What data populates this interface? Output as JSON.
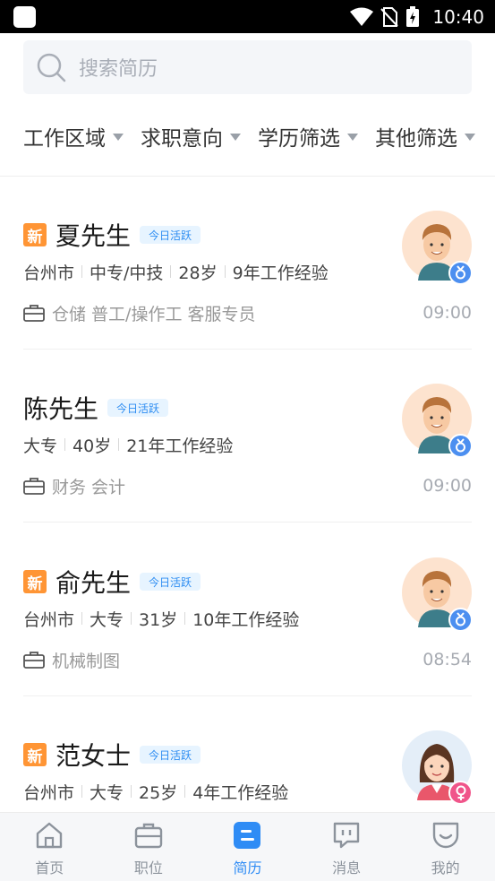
{
  "status_bar": {
    "time": "10:40"
  },
  "search": {
    "placeholder": "搜索简历"
  },
  "filters": [
    {
      "label": "工作区域"
    },
    {
      "label": "求职意向"
    },
    {
      "label": "学历筛选"
    },
    {
      "label": "其他筛选"
    }
  ],
  "candidates": [
    {
      "is_new": true,
      "new_label": "新",
      "name": "夏先生",
      "active_tag": "今日活跃",
      "info": [
        "台州市",
        "中专/中技",
        "28岁",
        "9年工作经验"
      ],
      "jobs": "仓储 普工/操作工 客服专员",
      "time": "09:00",
      "gender": "male"
    },
    {
      "is_new": false,
      "new_label": "",
      "name": "陈先生",
      "active_tag": "今日活跃",
      "info": [
        "大专",
        "40岁",
        "21年工作经验"
      ],
      "jobs": "财务 会计",
      "time": "09:00",
      "gender": "male"
    },
    {
      "is_new": true,
      "new_label": "新",
      "name": "俞先生",
      "active_tag": "今日活跃",
      "info": [
        "台州市",
        "大专",
        "31岁",
        "10年工作经验"
      ],
      "jobs": "机械制图",
      "time": "08:54",
      "gender": "male"
    },
    {
      "is_new": true,
      "new_label": "新",
      "name": "范女士",
      "active_tag": "今日活跃",
      "info": [
        "台州市",
        "大专",
        "25岁",
        "4年工作经验"
      ],
      "jobs": "",
      "time": "",
      "gender": "female"
    }
  ],
  "tabs": [
    {
      "label": "首页",
      "icon": "home-icon",
      "active": false
    },
    {
      "label": "职位",
      "icon": "briefcase-icon",
      "active": false
    },
    {
      "label": "简历",
      "icon": "resume-icon",
      "active": true
    },
    {
      "label": "消息",
      "icon": "message-icon",
      "active": false
    },
    {
      "label": "我的",
      "icon": "profile-icon",
      "active": false
    }
  ],
  "colors": {
    "accent": "#2f8cf5",
    "new_badge": "#ff9535",
    "male_badge": "#4c8ff0",
    "female_badge": "#f0558a"
  }
}
